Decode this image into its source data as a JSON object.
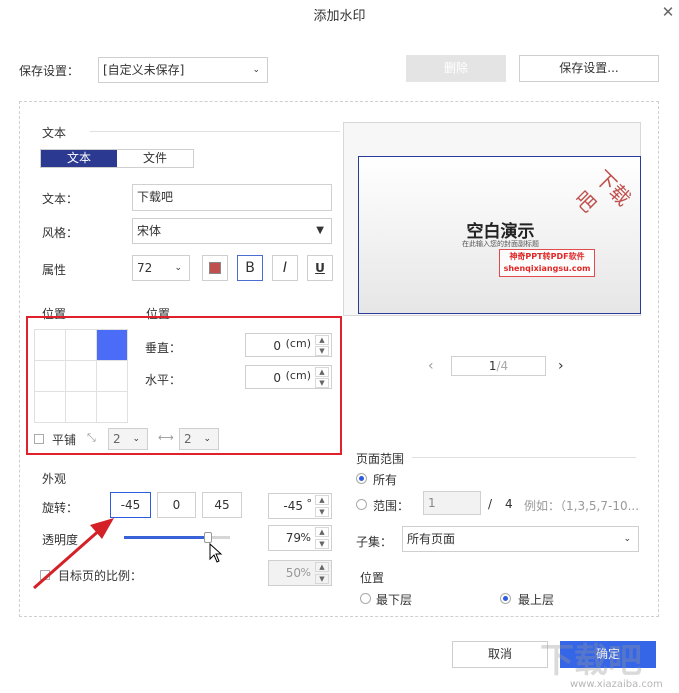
{
  "dialog": {
    "title": "添加水印"
  },
  "save_settings": {
    "label": "保存设置：",
    "preset": "[自定义未保存]",
    "delete_label": "删除",
    "save_label": "保存设置..."
  },
  "text_section": {
    "heading": "文本",
    "tabs": [
      "文本",
      "文件"
    ],
    "text_label": "文本：",
    "text_value": "下载吧",
    "style_label": "风格：",
    "style_value": "宋体",
    "attr_label": "属性",
    "font_size": "72",
    "bold": "B",
    "italic": "I",
    "underline": "U",
    "color": "#c0504d"
  },
  "position": {
    "heading_left": "位置",
    "heading_right": "位置",
    "vertical_label": "垂直：",
    "vertical_value": "0",
    "horizontal_label": "水平：",
    "horizontal_value": "0",
    "unit": "(cm)",
    "tile_label": "平铺",
    "tile_x": "2",
    "tile_y": "2"
  },
  "appearance": {
    "heading": "外观",
    "rotation_label": "旋转：",
    "rotation_presets": [
      "-45",
      "0",
      "45"
    ],
    "rotation_value": "-45",
    "rotation_unit": "°",
    "opacity_label": "透明度",
    "opacity_value": "79",
    "opacity_percent": 79,
    "opacity_unit": "%",
    "scale_label": "目标页的比例：",
    "scale_value": "50",
    "scale_unit": "%"
  },
  "preview": {
    "page_title": "空白演示",
    "page_subtitle": "在此输入您的封面副标题",
    "watermark": "下载吧",
    "stamp_line1": "神奇PPT转PDF软件",
    "stamp_line2": "shenqixiangsu.com",
    "current_page": "1",
    "total_pages": "/4",
    "prev": "‹",
    "next": "›"
  },
  "page_range": {
    "heading": "页面范围",
    "all_label": "所有",
    "range_label": "范围：",
    "range_from": "1",
    "slash": "/",
    "range_total": "4",
    "example": "例如：（1,3,5,7-10...",
    "subset_label": "子集：",
    "subset_value": "所有页面"
  },
  "layer": {
    "heading": "位置",
    "bottom_label": "最下层",
    "top_label": "最上层"
  },
  "footer": {
    "cancel_label": "取消",
    "ok_label": "确定"
  },
  "branding": {
    "watermark_text": "下载吧",
    "watermark_url": "www.xiazaiba.com"
  }
}
